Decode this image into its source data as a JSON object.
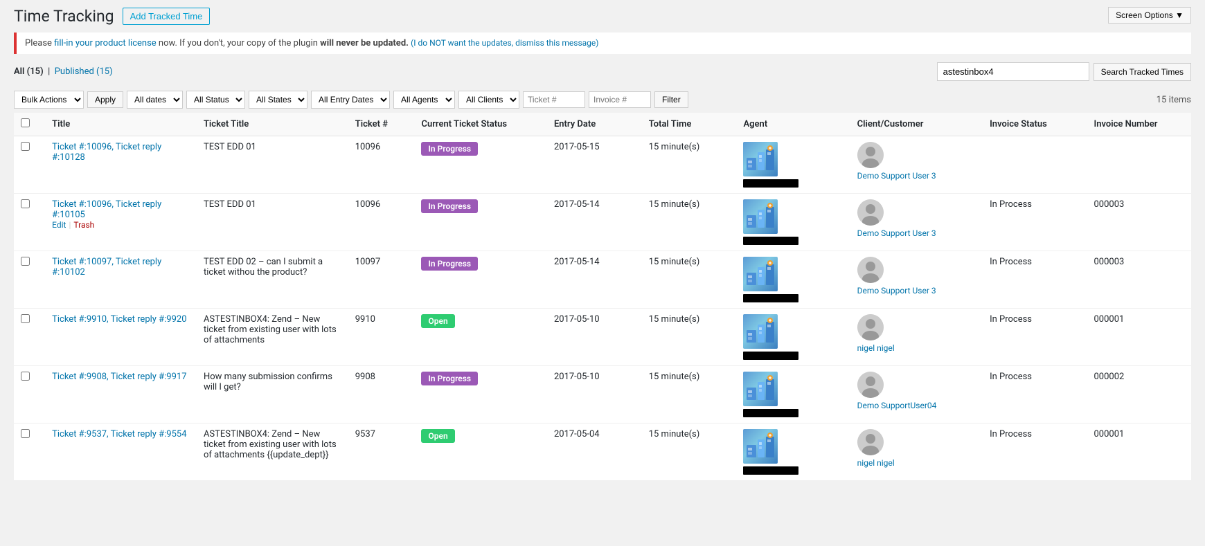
{
  "page": {
    "title": "Time Tracking",
    "screen_options_label": "Screen Options ▼"
  },
  "header": {
    "add_btn_label": "Add Tracked Time"
  },
  "notice": {
    "text_before": "Please ",
    "link_text": "fill-in your product license",
    "text_after": " now. If you don't, your copy of the plugin ",
    "bold_text": "will never be updated.",
    "dismiss_text": "(I do NOT want the updates, dismiss this message)"
  },
  "tabs": {
    "all_label": "All",
    "all_count": "15",
    "published_label": "Published",
    "published_count": "15"
  },
  "search": {
    "placeholder": "astestinbox4",
    "button_label": "Search Tracked Times"
  },
  "filters": {
    "bulk_actions": "Bulk Actions",
    "apply_label": "Apply",
    "dates_option": "All dates",
    "status_option": "All Status",
    "states_option": "All States",
    "entry_dates_option": "All Entry Dates",
    "agents_option": "All Agents",
    "clients_option": "All Clients",
    "ticket_placeholder": "Ticket #",
    "invoice_placeholder": "Invoice #",
    "filter_label": "Filter",
    "items_count": "15 items"
  },
  "table": {
    "columns": [
      "Title",
      "Ticket Title",
      "Ticket #",
      "Current Ticket Status",
      "Entry Date",
      "Total Time",
      "Agent",
      "Client/Customer",
      "Invoice Status",
      "Invoice Number"
    ],
    "rows": [
      {
        "id": 1,
        "title": "Ticket #:10096, Ticket reply #:10128",
        "ticket_title": "TEST EDD 01",
        "ticket_num": "10096",
        "status": "In Progress",
        "status_type": "in-progress",
        "entry_date": "2017-05-15",
        "total_time": "15 minute(s)",
        "client_name": "Demo Support User 3",
        "invoice_status": "",
        "invoice_number": "",
        "row_actions": []
      },
      {
        "id": 2,
        "title": "Ticket #:10096, Ticket reply #:10105",
        "ticket_title": "TEST EDD 01",
        "ticket_num": "10096",
        "status": "In Progress",
        "status_type": "in-progress",
        "entry_date": "2017-05-14",
        "total_time": "15 minute(s)",
        "client_name": "Demo Support User 3",
        "invoice_status": "In Process",
        "invoice_number": "000003",
        "row_actions": [
          "Edit",
          "Trash"
        ]
      },
      {
        "id": 3,
        "title": "Ticket #:10097, Ticket reply #:10102",
        "ticket_title": "TEST EDD 02 – can I submit a ticket withou the product?",
        "ticket_num": "10097",
        "status": "In Progress",
        "status_type": "in-progress",
        "entry_date": "2017-05-14",
        "total_time": "15 minute(s)",
        "client_name": "Demo Support User 3",
        "invoice_status": "In Process",
        "invoice_number": "000003",
        "row_actions": []
      },
      {
        "id": 4,
        "title": "Ticket #:9910, Ticket reply #:9920",
        "ticket_title": "ASTESTINBOX4: Zend – New ticket from existing user with lots of attachments",
        "ticket_num": "9910",
        "status": "Open",
        "status_type": "open",
        "entry_date": "2017-05-10",
        "total_time": "15 minute(s)",
        "client_name": "nigel nigel",
        "invoice_status": "In Process",
        "invoice_number": "000001",
        "row_actions": []
      },
      {
        "id": 5,
        "title": "Ticket #:9908, Ticket reply #:9917",
        "ticket_title": "How many submission confirms will I get?",
        "ticket_num": "9908",
        "status": "In Progress",
        "status_type": "in-progress",
        "entry_date": "2017-05-10",
        "total_time": "15 minute(s)",
        "client_name": "Demo SupportUser04",
        "invoice_status": "In Process",
        "invoice_number": "000002",
        "row_actions": []
      },
      {
        "id": 6,
        "title": "Ticket #:9537, Ticket reply #:9554",
        "ticket_title": "ASTESTINBOX4: Zend – New ticket from existing user with lots of attachments {{update_dept}}",
        "ticket_num": "9537",
        "status": "Open",
        "status_type": "open",
        "entry_date": "2017-05-04",
        "total_time": "15 minute(s)",
        "client_name": "nigel nigel",
        "invoice_status": "In Process",
        "invoice_number": "000001",
        "row_actions": []
      }
    ]
  }
}
